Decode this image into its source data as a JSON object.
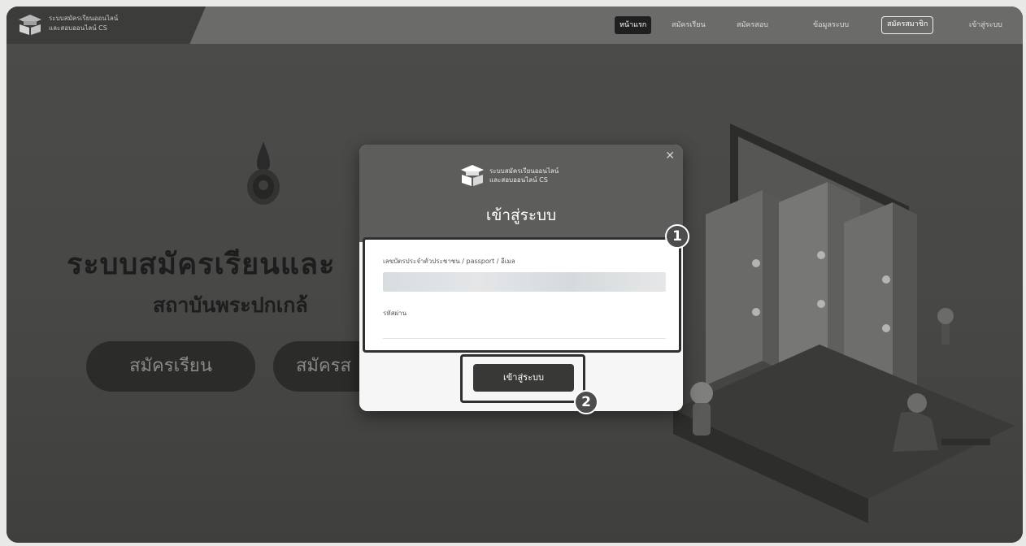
{
  "brand": {
    "line1": "ระบบสมัครเรียนออนไลน์",
    "line2": "และสอบออนไลน์ CS",
    "logo_icon": "graduation-book-icon"
  },
  "nav": {
    "items": [
      {
        "label": "หน้าแรก",
        "active": true
      },
      {
        "label": "สมัครเรียน"
      },
      {
        "label": "สมัครสอบ"
      },
      {
        "label": "ข้อมูลระบบ"
      },
      {
        "label": "สมัครสมาชิก",
        "outlined": true
      },
      {
        "label": "เข้าสู่ระบบ"
      }
    ]
  },
  "hero": {
    "title": "ระบบสมัครเรียนและ",
    "subtitle": "สถาบันพระปกเกล้",
    "buttons": [
      "สมัครเรียน",
      "สมัครส"
    ]
  },
  "modal": {
    "close_icon": "close-icon",
    "brand_line1": "ระบบสมัครเรียนออนไลน์",
    "brand_line2": "และสอบออนไลน์ CS",
    "title": "เข้าสู่ระบบ",
    "id_label": "เลขบัตรประจำตัวประชาชน / passport / อีเมล",
    "password_label": "รหัสผ่าน",
    "submit_label": "เข้าสู่ระบบ",
    "steps": [
      "1",
      "2"
    ]
  },
  "colors": {
    "overlay": "#4a4a48",
    "annotation": "#2f2f2f",
    "badge": "#4d4d4d"
  }
}
